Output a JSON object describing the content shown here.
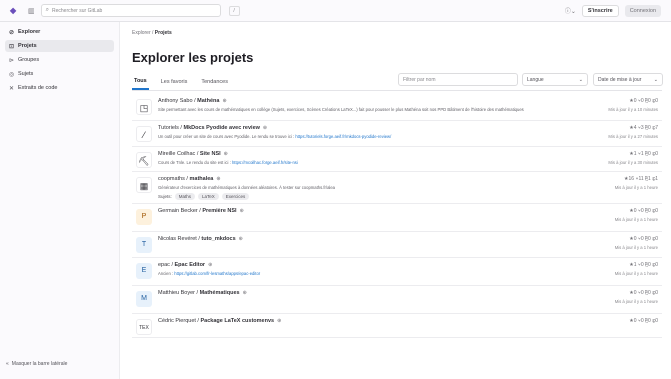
{
  "topbar": {
    "search_placeholder": "Rechercher sur GitLab",
    "kbd": "/",
    "help_icon": "question-icon",
    "signin": "S'inscrire",
    "register": "Connexion"
  },
  "sidebar": {
    "items": [
      {
        "icon": "⊘",
        "label": "Explorer"
      },
      {
        "icon": "⊡",
        "label": "Projets"
      },
      {
        "icon": "⊳",
        "label": "Groupes"
      },
      {
        "icon": "◎",
        "label": "Sujets"
      },
      {
        "icon": "✕",
        "label": "Extraits de code"
      }
    ],
    "collapse": "Masquer la barre latérale"
  },
  "breadcrumb": {
    "root": "Explorer",
    "sep": "/",
    "current": "Projets"
  },
  "title": "Explorer les projets",
  "tabs": [
    "Tous",
    "Les favoris",
    "Tendances"
  ],
  "filter_placeholder": "Filtrer par nom",
  "language_select": "Langue",
  "sort_select": "Date de mise à jour",
  "projects": [
    {
      "avatar_type": "img",
      "avatar_glyph": "◳",
      "owner": "Anthony Sabo / ",
      "name": "Mathéna",
      "desc": "Site permettant avec les cours de mathématiques en collège (Sujets, exercices, Scènes Créations LaTeX...) fait pour pousser le plus Mathéna soit nos PPD Bâtiment de l'histoire des mathématiques",
      "desc_link": "",
      "topics": [],
      "stats": "★0  ⑂0  ⎘0  ⓘ0",
      "updated": "Mis à jour il y a 10 minutes"
    },
    {
      "avatar_type": "img",
      "avatar_glyph": "⁄",
      "owner": "Tutoriels / ",
      "name": "MkDocs Pyodide avec review",
      "desc": "Un outil pour créer un site de cours avec Pyodide. Le rendu se trouve ici : ",
      "desc_link": "https://tutoriels.forge.aeif.fr/mkdocs-pyodide-review/",
      "topics": [],
      "stats": "★4  ⑂3  ⎘0  ⓘ7",
      "updated": "Mis à jour il y a 27 minutes"
    },
    {
      "avatar_type": "img",
      "avatar_glyph": "⛏",
      "owner": "Mireille Coilhac / ",
      "name": "Site NSI",
      "desc": "Cours de Tnle. Le rendu du site est ici : ",
      "desc_link": "https://mcoilhac.forge.aeif.fr/site-nsi",
      "topics": [],
      "stats": "★1  ⑂1  ⎘0  ⓘ0",
      "updated": "Mis à jour il y a 30 minutes"
    },
    {
      "avatar_type": "img",
      "avatar_glyph": "▦",
      "owner": "coopmaths / ",
      "name": "mathalea",
      "desc": "Générateur d'exercices de mathématiques à données aléatoires. À tester sur coopmaths.fr/alea",
      "desc_link": "",
      "topics_label": "Sujets:",
      "topics": [
        "Maths",
        "LaTeX",
        "Exercices"
      ],
      "stats": "★16  ⑂11  ⎘1  ⓘ1",
      "updated": "Mis à jour il y a 1 heure"
    },
    {
      "avatar_type": "letter orange",
      "avatar_glyph": "P",
      "owner": "Germain Becker / ",
      "name": "Première NSI",
      "desc": "",
      "desc_link": "",
      "topics": [],
      "stats": "★0  ⑂0  ⎘0  ⓘ0",
      "updated": "Mis à jour il y a 1 heure"
    },
    {
      "avatar_type": "letter",
      "avatar_glyph": "T",
      "owner": "Nicolas Revéret / ",
      "name": "tuto_mkdocs",
      "desc": "",
      "desc_link": "",
      "topics": [],
      "stats": "★0  ⑂0  ⎘0  ⓘ0",
      "updated": "Mis à jour il y a 1 heure"
    },
    {
      "avatar_type": "letter",
      "avatar_glyph": "E",
      "owner": "epac / ",
      "name": "Epac Editor",
      "desc": "Ancien : ",
      "desc_link": "https://gitlab.com/fr-lesmaths/apps/epac-editor",
      "topics": [],
      "stats": "★1  ⑂0  ⎘0  ⓘ0",
      "updated": "Mis à jour il y a 1 heure"
    },
    {
      "avatar_type": "letter",
      "avatar_glyph": "M",
      "owner": "Matthieu Boyer / ",
      "name": "Mathématiques",
      "desc": "",
      "desc_link": "",
      "topics": [],
      "stats": "★0  ⑂0  ⎘0  ⓘ0",
      "updated": "Mis à jour il y a 1 heure"
    },
    {
      "avatar_type": "img",
      "avatar_glyph": "TEX",
      "owner": "Cédric Pierquet / ",
      "name": "Package LaTeX customenvs",
      "desc": "",
      "desc_link": "",
      "topics": [],
      "stats": "★0  ⑂0  ⎘0  ⓘ0",
      "updated": ""
    }
  ]
}
